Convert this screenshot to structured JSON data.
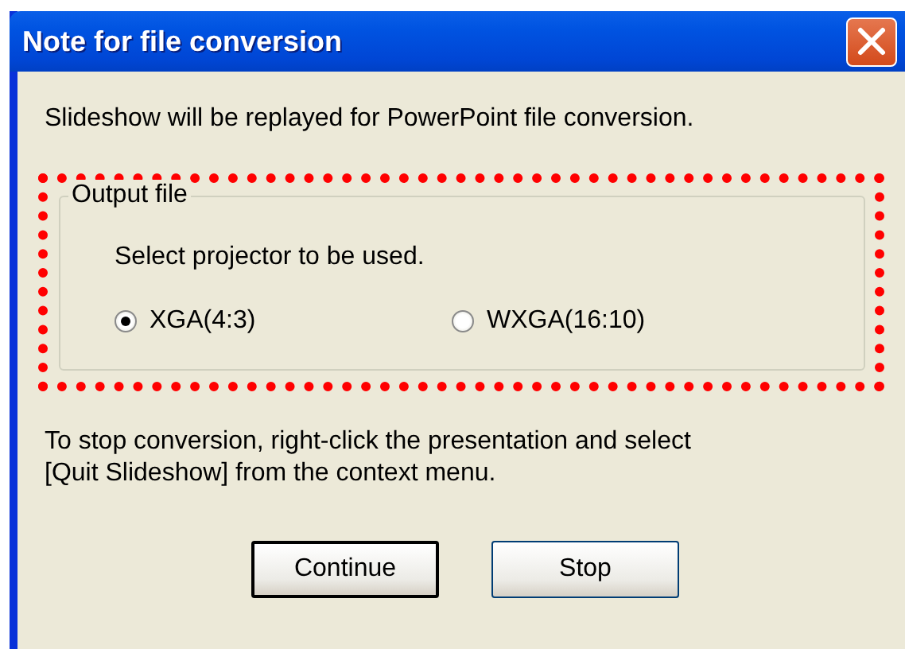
{
  "window": {
    "title": "Note for file conversion"
  },
  "intro": "Slideshow will be replayed for PowerPoint file conversion.",
  "group": {
    "legend": "Output file",
    "prompt": "Select projector to be used.",
    "options": [
      {
        "label": "XGA(4:3)",
        "selected": true
      },
      {
        "label": "WXGA(16:10)",
        "selected": false
      }
    ]
  },
  "note": "To stop conversion, right-click the presentation and select [Quit Slideshow] from the context menu.",
  "buttons": [
    {
      "label": "Continue",
      "default": true
    },
    {
      "label": "Stop",
      "default": false
    }
  ]
}
